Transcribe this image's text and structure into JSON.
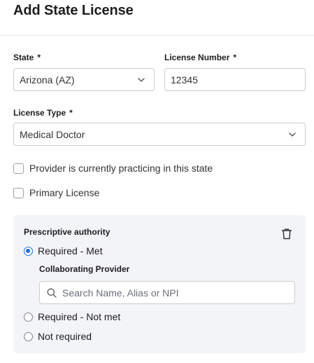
{
  "dialog": {
    "title": "Add State License"
  },
  "state": {
    "label": "State",
    "required_mark": "*",
    "value": "Arizona (AZ)"
  },
  "license_number": {
    "label": "License Number",
    "required_mark": "*",
    "value": "12345"
  },
  "license_type": {
    "label": "License Type",
    "required_mark": "*",
    "value": "Medical Doctor"
  },
  "checkboxes": {
    "practicing": {
      "label": "Provider is currently practicing in this state",
      "checked": false
    },
    "primary": {
      "label": "Primary License",
      "checked": false
    }
  },
  "prescriptive": {
    "title": "Prescriptive authority",
    "options": [
      {
        "label": "Required - Met",
        "selected": true
      },
      {
        "label": "Required - Not met",
        "selected": false
      },
      {
        "label": "Not required",
        "selected": false
      }
    ],
    "collaborating": {
      "label": "Collaborating Provider",
      "placeholder": "Search Name, Alias or NPI"
    }
  },
  "colors": {
    "accent": "#1f6fe0",
    "panel_bg": "#f3f4f6",
    "border": "#c9ccd1"
  },
  "icons": [
    "chevron-down-icon",
    "trash-icon",
    "search-icon"
  ]
}
